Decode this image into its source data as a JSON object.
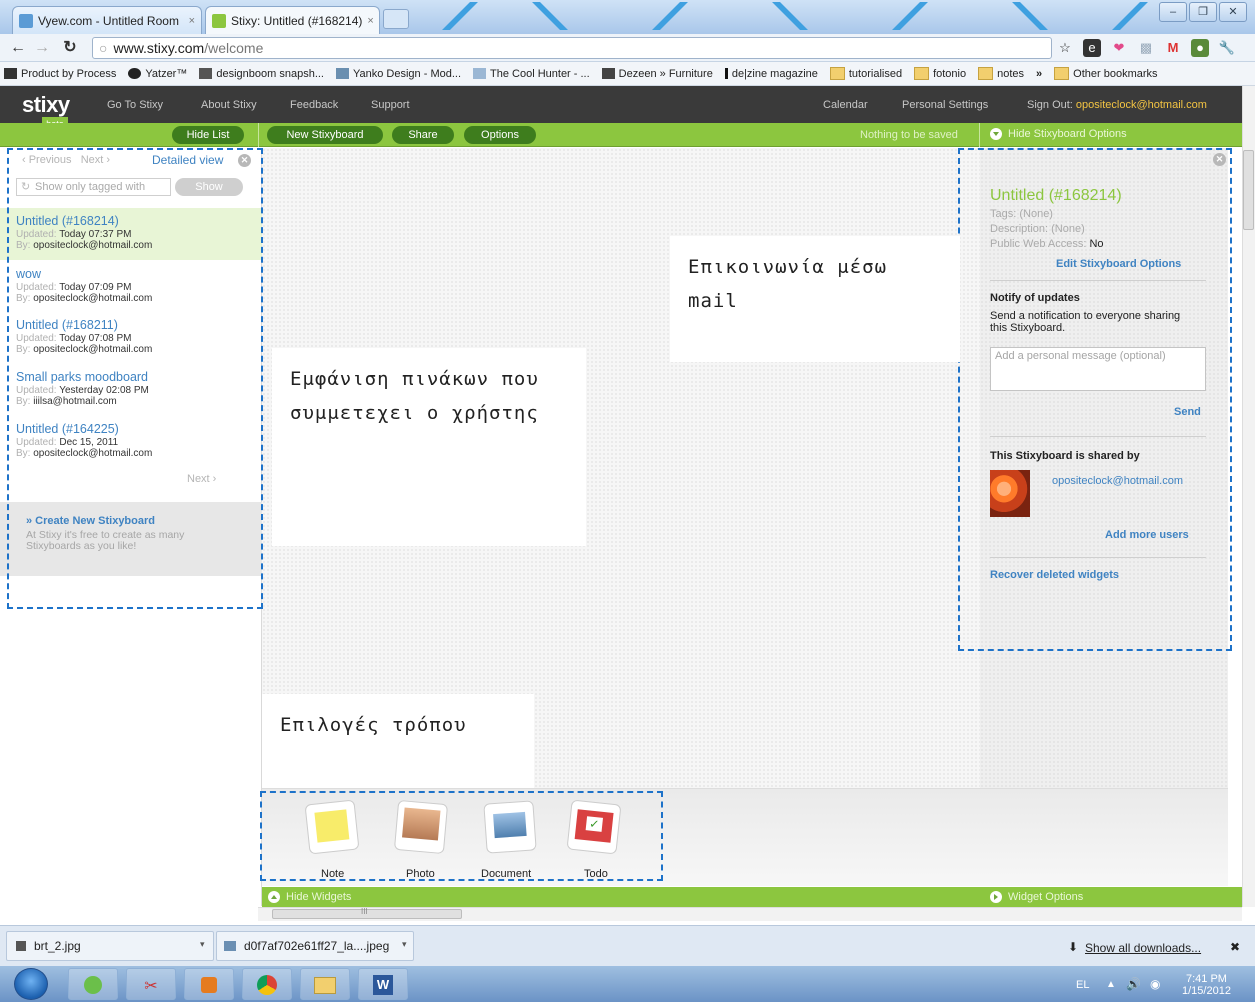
{
  "browser": {
    "tabs": [
      {
        "label": "Vyew.com - Untitled Room",
        "close": "×"
      },
      {
        "label": "Stixy: Untitled (#168214)",
        "close": "×"
      }
    ],
    "window_buttons": [
      "–",
      "❐",
      "✕"
    ],
    "url_domain": "www.stixy.com",
    "url_path": "/welcome",
    "bookmarks": [
      "Product by Process",
      "Yatzer™",
      "designboom snapsh...",
      "Yanko Design - Mod...",
      "The Cool Hunter - ...",
      "Dezeen » Furniture",
      "de|zine magazine",
      "tutorialised",
      "fotonio",
      "notes",
      "»",
      "Other bookmarks"
    ]
  },
  "stixy": {
    "logo": "stixy",
    "logo_badge": "beta",
    "nav": [
      "Go To Stixy",
      "About Stixy",
      "Feedback",
      "Support"
    ],
    "calendar": "Calendar",
    "personal_settings": "Personal Settings",
    "signout_label": "Sign Out:",
    "signout_email": "opositeclock@hotmail.com",
    "toolbar": {
      "hide_list": "Hide List",
      "new_board": "New Stixyboard",
      "share": "Share",
      "options": "Options",
      "nothing_saved": "Nothing to be saved",
      "hide_board_options": "Hide Stixyboard Options"
    }
  },
  "list": {
    "previous": "‹ Previous",
    "next": "Next ›",
    "detailed_view": "Detailed view",
    "tag_placeholder": "Show only tagged with",
    "show_button": "Show",
    "updated_label": "Updated:",
    "by_label": "By:",
    "boards": [
      {
        "title": "Untitled (#168214)",
        "updated": "Today 07:37 PM",
        "by": "opositeclock@hotmail.com"
      },
      {
        "title": "wow",
        "updated": "Today 07:09 PM",
        "by": "opositeclock@hotmail.com"
      },
      {
        "title": "Untitled (#168211)",
        "updated": "Today 07:08 PM",
        "by": "opositeclock@hotmail.com"
      },
      {
        "title": "Small parks moodboard",
        "updated": "Yesterday 02:08 PM",
        "by": "iiilsa@hotmail.com"
      },
      {
        "title": "Untitled (#164225)",
        "updated": "Dec 15, 2011",
        "by": "opositeclock@hotmail.com"
      }
    ],
    "next_bottom": "Next ›",
    "create_link": "» Create New Stixyboard",
    "create_desc": "At Stixy it's free to create as many Stixyboards as you like!"
  },
  "options_panel": {
    "title": "Untitled (#168214)",
    "tags": "Tags: (None)",
    "description": "Description: (None)",
    "public_label": "Public Web Access:",
    "public_value": "No",
    "edit_link": "Edit Stixyboard Options",
    "notify_head": "Notify of updates",
    "notify_desc": "Send a notification to everyone sharing this Stixyboard.",
    "message_placeholder": "Add a personal message (optional)",
    "send": "Send",
    "shared_head": "This Stixyboard is shared by",
    "shared_user": "opositeclock@hotmail.com",
    "add_users": "Add more users",
    "recover": "Recover deleted widgets"
  },
  "annotations": {
    "left": "Εμφάνιση πινάκων που συμμετεχει ο χρήστης",
    "right": "Επικοινωνία μέσω mail",
    "bottom": "Επιλογές τρόπου"
  },
  "widgets": [
    {
      "label": "Note",
      "icon": "note-icon"
    },
    {
      "label": "Photo",
      "icon": "photo-icon"
    },
    {
      "label": "Document",
      "icon": "document-icon"
    },
    {
      "label": "Todo",
      "icon": "todo-icon"
    }
  ],
  "bottom": {
    "hide_widgets": "Hide Widgets",
    "widget_options": "Widget Options",
    "scroll_mark": "III"
  },
  "downloads": {
    "files": [
      "brt_2.jpg",
      "d0f7af702e61ff27_la....jpeg"
    ],
    "show_all": "Show all downloads...",
    "close": "✖"
  },
  "taskbar": {
    "lang": "EL",
    "time": "7:41 PM",
    "date": "1/15/2012"
  },
  "colors": {
    "stixy_green": "#8cc63f",
    "link_blue": "#3f83c2",
    "dash_blue": "#1d72c9"
  }
}
